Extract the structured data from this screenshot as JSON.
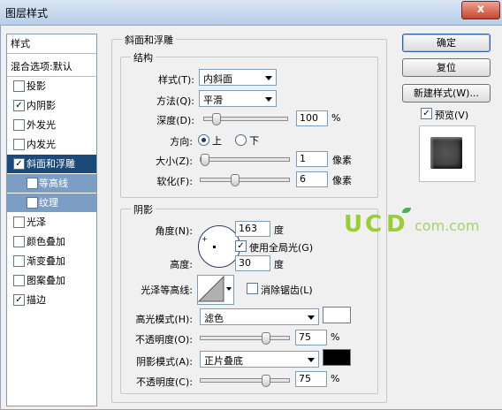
{
  "window": {
    "title": "图层样式",
    "close_glyph": "x"
  },
  "sidebar": {
    "header": "样式",
    "blend": "混合选项:默认",
    "items": [
      {
        "label": "投影",
        "checked": false
      },
      {
        "label": "内阴影",
        "checked": true
      },
      {
        "label": "外发光",
        "checked": false
      },
      {
        "label": "内发光",
        "checked": false
      },
      {
        "label": "斜面和浮雕",
        "checked": true
      },
      {
        "label": "等高线",
        "checked": false
      },
      {
        "label": "纹理",
        "checked": false
      },
      {
        "label": "光泽",
        "checked": false
      },
      {
        "label": "颜色叠加",
        "checked": false
      },
      {
        "label": "渐变叠加",
        "checked": false
      },
      {
        "label": "图案叠加",
        "checked": false
      },
      {
        "label": "描边",
        "checked": true
      }
    ]
  },
  "bevel": {
    "section_title": "斜面和浮雕",
    "structure": {
      "title": "结构",
      "style_label": "样式(T):",
      "style_value": "内斜面",
      "technique_label": "方法(Q):",
      "technique_value": "平滑",
      "depth_label": "深度(D):",
      "depth_value": "100",
      "depth_unit": "%",
      "depth_fraction": 0.1,
      "direction_label": "方向:",
      "direction_up": "上",
      "direction_down": "下",
      "direction_selected": "上",
      "size_label": "大小(Z):",
      "size_value": "1",
      "size_unit": "像素",
      "size_fraction": 0.0,
      "soften_label": "软化(F):",
      "soften_value": "6",
      "soften_unit": "像素",
      "soften_fraction": 0.37
    },
    "shading": {
      "title": "阴影",
      "angle_label": "角度(N):",
      "angle_value": "163",
      "angle_unit": "度",
      "global_light_label": "使用全局光(G)",
      "global_light_checked": true,
      "altitude_label": "高度:",
      "altitude_value": "30",
      "altitude_unit": "度",
      "gloss_contour_label": "光泽等高线:",
      "antialias_label": "消除锯齿(L)",
      "antialias_checked": false,
      "highlight_mode_label": "高光模式(H):",
      "highlight_mode_value": "滤色",
      "highlight_color": "#ffffff",
      "highlight_opacity_label": "不透明度(O):",
      "highlight_opacity_value": "75",
      "highlight_opacity_unit": "%",
      "highlight_opacity_fraction": 0.75,
      "shadow_mode_label": "阴影模式(A):",
      "shadow_mode_value": "正片叠底",
      "shadow_color": "#000000",
      "shadow_opacity_label": "不透明度(C):",
      "shadow_opacity_value": "75",
      "shadow_opacity_unit": "%",
      "shadow_opacity_fraction": 0.75
    }
  },
  "buttons": {
    "ok": "确定",
    "reset": "复位",
    "new_style": "新建样式(W)...",
    "preview_label": "预览(V)",
    "preview_checked": true
  },
  "watermark": {
    "u": "U",
    "c": "C",
    "d": "D",
    "suffix": "com.com"
  }
}
